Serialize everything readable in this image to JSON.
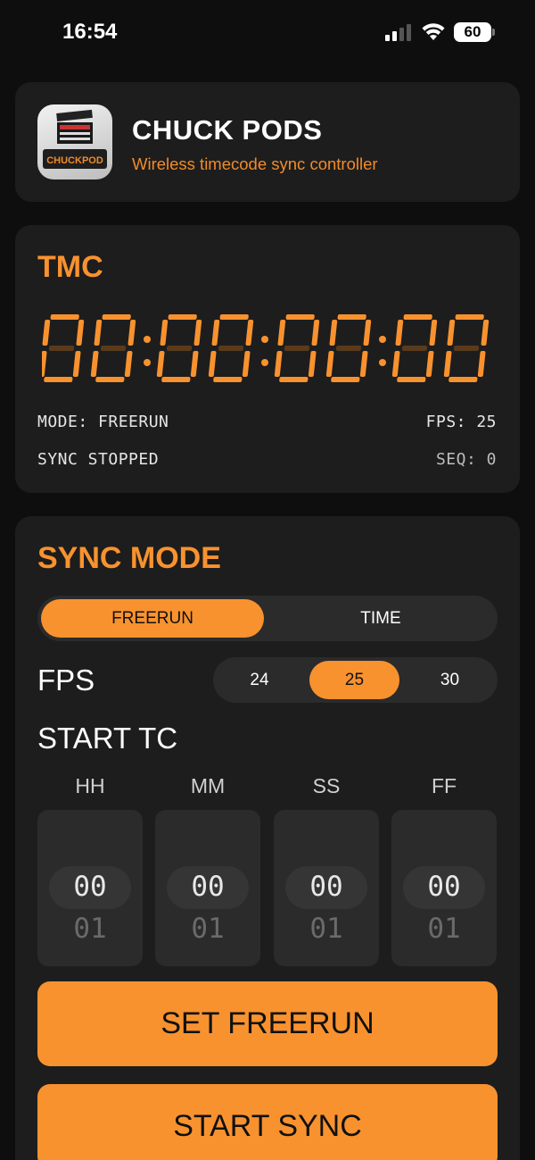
{
  "status_bar": {
    "time": "16:54",
    "battery": "60"
  },
  "header": {
    "app_name": "CHUCK PODS",
    "subtitle": "Wireless timecode sync controller",
    "icon_text": "CHUCKPOD"
  },
  "tmc": {
    "title": "TMC",
    "timecode_digits": [
      "0",
      "0",
      "0",
      "0",
      "0",
      "0",
      "0",
      "0"
    ],
    "mode_text": "MODE: FREERUN",
    "fps_text": "FPS: 25",
    "sync_text": "SYNC STOPPED",
    "seq_text": "SEQ: 0"
  },
  "sync_mode": {
    "title": "SYNC MODE",
    "modes": [
      "FREERUN",
      "TIME"
    ],
    "selected_mode": "FREERUN",
    "fps_label": "FPS",
    "fps_options": [
      "24",
      "25",
      "30"
    ],
    "selected_fps": "25",
    "start_tc_label": "START TC",
    "columns": [
      {
        "label": "HH",
        "value": "00",
        "next": "01"
      },
      {
        "label": "MM",
        "value": "00",
        "next": "01"
      },
      {
        "label": "SS",
        "value": "00",
        "next": "01"
      },
      {
        "label": "FF",
        "value": "00",
        "next": "01"
      }
    ],
    "set_button": "SET FREERUN",
    "start_button": "START SYNC"
  },
  "colors": {
    "accent": "#f8922f",
    "card": "#1d1d1d",
    "background": "#0e0e0e",
    "subtitle": "#f28b2a"
  }
}
